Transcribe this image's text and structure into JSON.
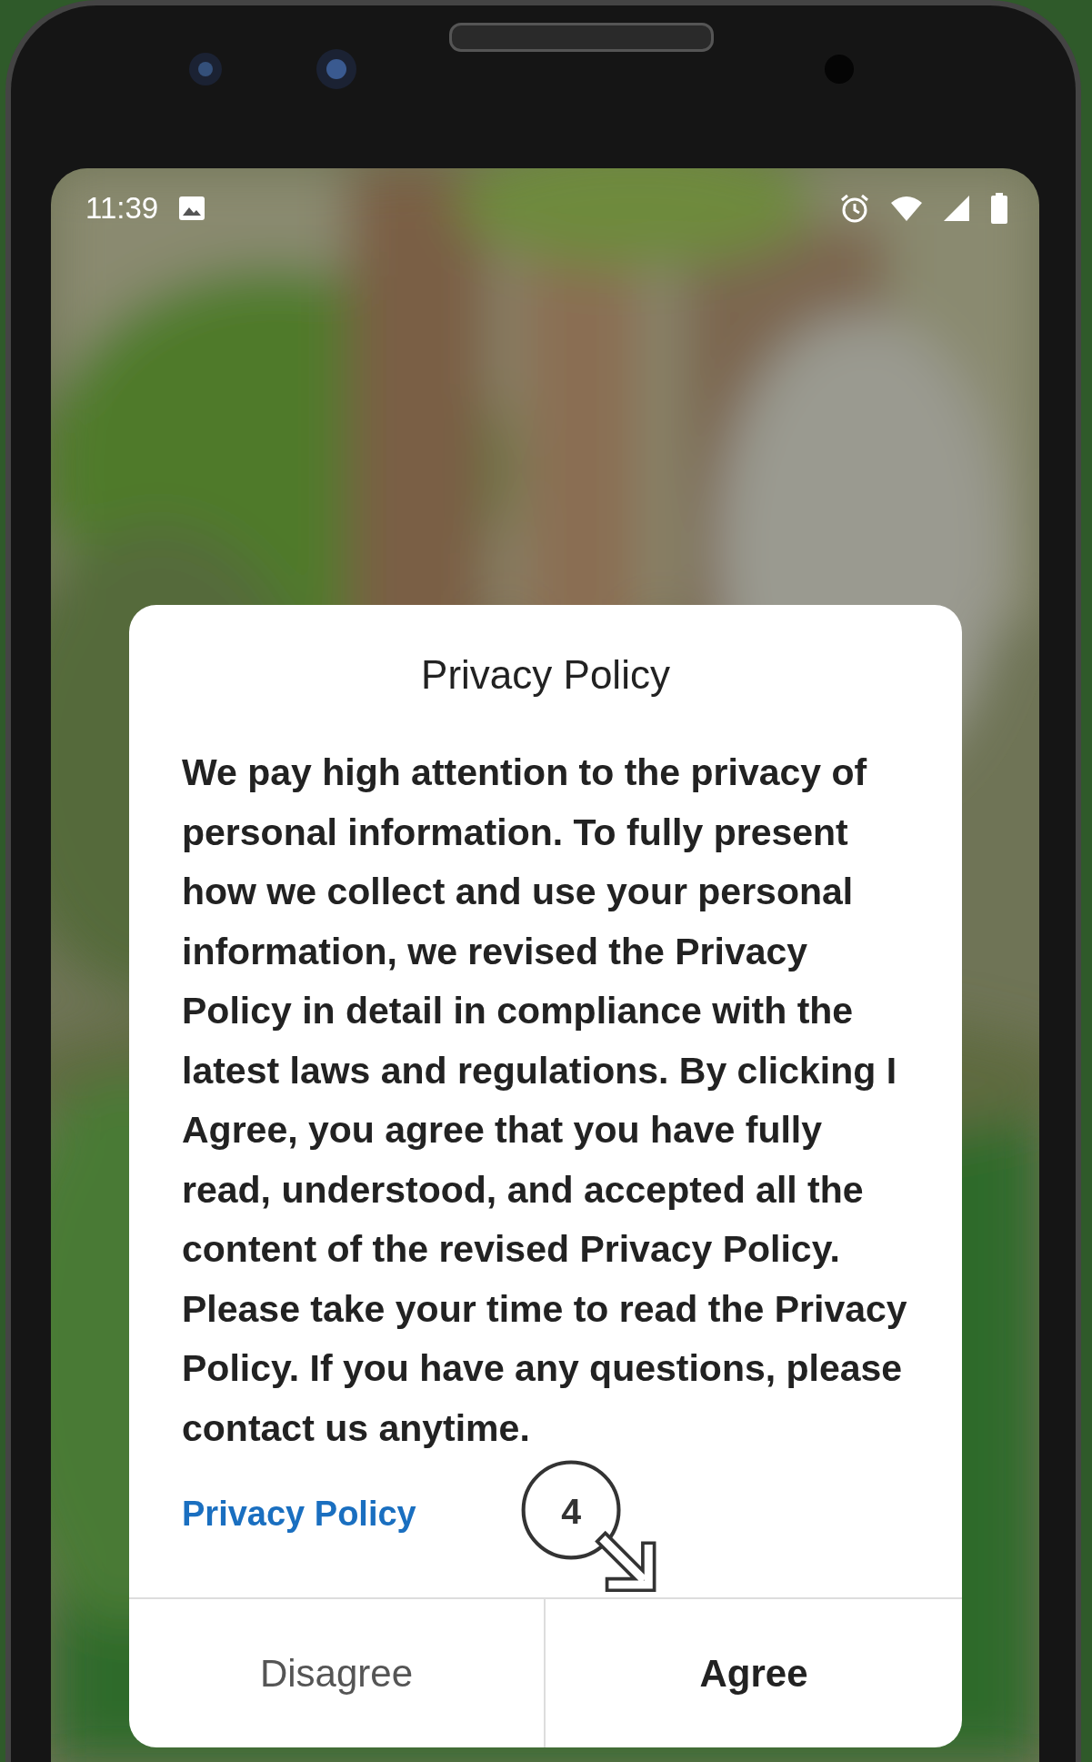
{
  "status_bar": {
    "time": "11:39"
  },
  "dialog": {
    "title": "Privacy Policy",
    "body": "We pay high attention to the privacy of personal information. To fully present how we collect and use your personal information, we revised the Privacy Policy in detail in compliance with the latest laws and regulations. By clicking I Agree, you agree that you have fully read, understood, and accepted all the content of the revised Privacy Policy. Please take your time to read the Privacy Policy. If you have any questions, please contact us anytime.",
    "link": "Privacy Policy",
    "buttons": [
      {
        "label": "Disagree",
        "kind": "secondary"
      },
      {
        "label": "Agree",
        "kind": "primary"
      }
    ]
  },
  "annotation": {
    "step": "4"
  }
}
